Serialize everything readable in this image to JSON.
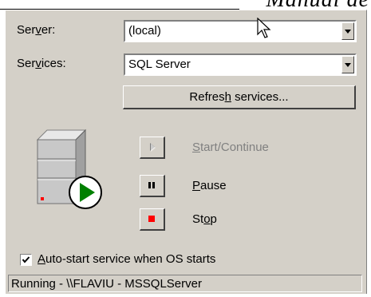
{
  "document": {
    "header_fragment": "Manual de"
  },
  "dialog": {
    "server_label_pre": "Ser",
    "server_label_ul": "v",
    "server_label_post": "er:",
    "server_value": "(local)",
    "services_label_pre": "Ser",
    "services_label_ul": "v",
    "services_label_post": "ices:",
    "services_value": "SQL Server",
    "refresh_pre": "Refres",
    "refresh_ul": "h",
    "refresh_post": " services...",
    "start_label": "Start/Continue",
    "start_ul": "S",
    "start_rest": "tart/Continue",
    "pause_ul": "P",
    "pause_rest": "ause",
    "stop_pre": "St",
    "stop_ul": "o",
    "stop_post": "p",
    "autostart_ul": "A",
    "autostart_rest": "uto-start service when OS starts",
    "autostart_checked": true,
    "status_text": "Running - \\\\FLAVIU - MSSQLServer"
  },
  "colors": {
    "dialog_bg": "#d4d0c8",
    "stop_red": "#ff0000",
    "play_green": "#008000",
    "disabled_text": "#808080"
  },
  "icons": {
    "server": "server-icon",
    "play": "play-icon",
    "pause": "pause-icon",
    "stop": "stop-icon",
    "cursor": "mouse-cursor-icon"
  }
}
